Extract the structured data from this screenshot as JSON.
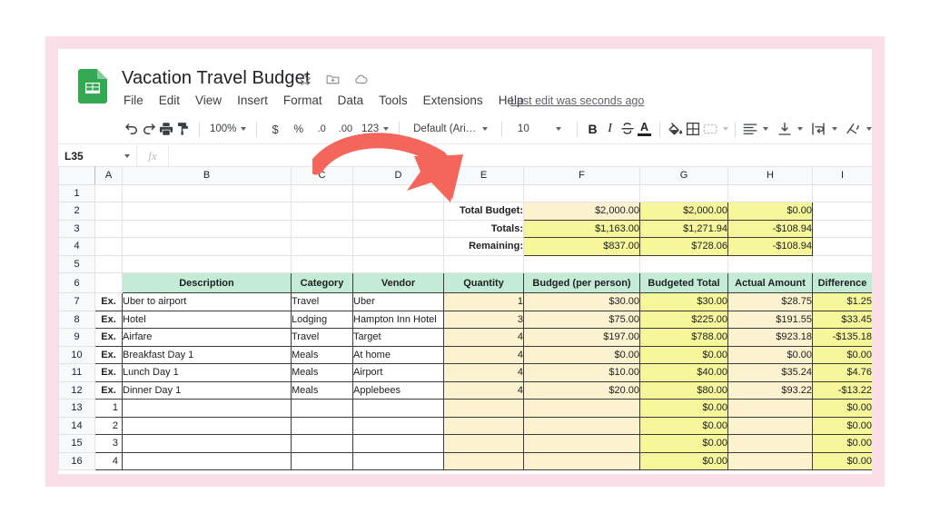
{
  "app": {
    "logo_icon": "google-sheets-icon",
    "doc_title": "Vacation Travel Budget",
    "title_icons": [
      "star-icon",
      "move-to-folder-icon",
      "cloud-saved-icon"
    ],
    "menu": [
      "File",
      "Edit",
      "View",
      "Insert",
      "Format",
      "Data",
      "Tools",
      "Extensions",
      "Help"
    ],
    "last_edit": "Last edit was seconds ago"
  },
  "toolbar": {
    "undo_icon": "undo-icon",
    "redo_icon": "redo-icon",
    "print_icon": "print-icon",
    "paint_format_icon": "paint-format-icon",
    "zoom_value": "100%",
    "currency_label": "$",
    "percent_label": "%",
    "decrease_decimal_label": ".0",
    "increase_decimal_label": ".00",
    "more_formats_label": "123",
    "font_name": "Default (Ari…",
    "font_size": "10",
    "bold_label": "B",
    "italic_label": "I",
    "strikethrough_label": "S",
    "text_color_label": "A",
    "fill_color_icon": "fill-color-icon",
    "borders_icon": "borders-icon",
    "merge_cells_icon": "merge-cells-icon",
    "halign_icon": "horizontal-align-icon",
    "valign_icon": "vertical-align-icon",
    "text_wrap_icon": "text-wrapping-icon",
    "text_rotate_icon": "text-rotation-icon"
  },
  "formula_bar": {
    "cell_reference": "L35",
    "fx_label": "fx",
    "formula_value": ""
  },
  "grid": {
    "column_letters": [
      "A",
      "B",
      "C",
      "D",
      "E",
      "F",
      "G",
      "H",
      "I"
    ],
    "row_numbers": [
      "1",
      "2",
      "3",
      "4",
      "5",
      "6",
      "7",
      "8",
      "9",
      "10",
      "11",
      "12",
      "13",
      "14",
      "15",
      "16"
    ]
  },
  "summary": {
    "rows": [
      {
        "label": "Total Budget:",
        "budget": "$2,000.00",
        "total": "$2,000.00",
        "actual": "$0.00"
      },
      {
        "label": "Totals:",
        "budget": "$1,163.00",
        "total": "$1,271.94",
        "actual": "-$108.94"
      },
      {
        "label": "Remaining:",
        "budget": "$837.00",
        "total": "$728.06",
        "actual": "-$108.94"
      }
    ]
  },
  "table": {
    "headers": [
      "Description",
      "Category",
      "Vendor",
      "Quantity",
      "Budged (per person)",
      "Budgeted Total",
      "Actual Amount",
      "Difference"
    ],
    "rows": [
      {
        "a": "Ex.",
        "description": "Uber to airport",
        "category": "Travel",
        "vendor": "Uber",
        "quantity": "1",
        "budget_per_person": "$30.00",
        "budgeted_total": "$30.00",
        "actual_amount": "$28.75",
        "difference": "$1.25"
      },
      {
        "a": "Ex.",
        "description": "Hotel",
        "category": "Lodging",
        "vendor": "Hampton Inn Hotel",
        "quantity": "3",
        "budget_per_person": "$75.00",
        "budgeted_total": "$225.00",
        "actual_amount": "$191.55",
        "difference": "$33.45"
      },
      {
        "a": "Ex.",
        "description": "Airfare",
        "category": "Travel",
        "vendor": "Target",
        "quantity": "4",
        "budget_per_person": "$197.00",
        "budgeted_total": "$788.00",
        "actual_amount": "$923.18",
        "difference": "-$135.18"
      },
      {
        "a": "Ex.",
        "description": "Breakfast Day 1",
        "category": "Meals",
        "vendor": "At home",
        "quantity": "4",
        "budget_per_person": "$0.00",
        "budgeted_total": "$0.00",
        "actual_amount": "$0.00",
        "difference": "$0.00"
      },
      {
        "a": "Ex.",
        "description": "Lunch Day 1",
        "category": "Meals",
        "vendor": "Airport",
        "quantity": "4",
        "budget_per_person": "$10.00",
        "budgeted_total": "$40.00",
        "actual_amount": "$35.24",
        "difference": "$4.76"
      },
      {
        "a": "Ex.",
        "description": "Dinner Day 1",
        "category": "Meals",
        "vendor": "Applebees",
        "quantity": "4",
        "budget_per_person": "$20.00",
        "budgeted_total": "$80.00",
        "actual_amount": "$93.22",
        "difference": "-$13.22"
      },
      {
        "a": "1",
        "description": "",
        "category": "",
        "vendor": "",
        "quantity": "",
        "budget_per_person": "",
        "budgeted_total": "$0.00",
        "actual_amount": "",
        "difference": "$0.00"
      },
      {
        "a": "2",
        "description": "",
        "category": "",
        "vendor": "",
        "quantity": "",
        "budget_per_person": "",
        "budgeted_total": "$0.00",
        "actual_amount": "",
        "difference": "$0.00"
      },
      {
        "a": "3",
        "description": "",
        "category": "",
        "vendor": "",
        "quantity": "",
        "budget_per_person": "",
        "budgeted_total": "$0.00",
        "actual_amount": "",
        "difference": "$0.00"
      },
      {
        "a": "4",
        "description": "",
        "category": "",
        "vendor": "",
        "quantity": "",
        "budget_per_person": "",
        "budgeted_total": "$0.00",
        "actual_amount": "",
        "difference": "$0.00"
      }
    ]
  },
  "annotation": {
    "arrow_icon": "curved-arrow-annotation",
    "arrow_color": "#f4655c"
  },
  "colors": {
    "frame": "#fbdfe8",
    "header_mint": "#c3ebd6",
    "fill_cream": "#fdf2d0",
    "fill_yellow": "#f6f69a",
    "sheets_green": "#34a853"
  }
}
